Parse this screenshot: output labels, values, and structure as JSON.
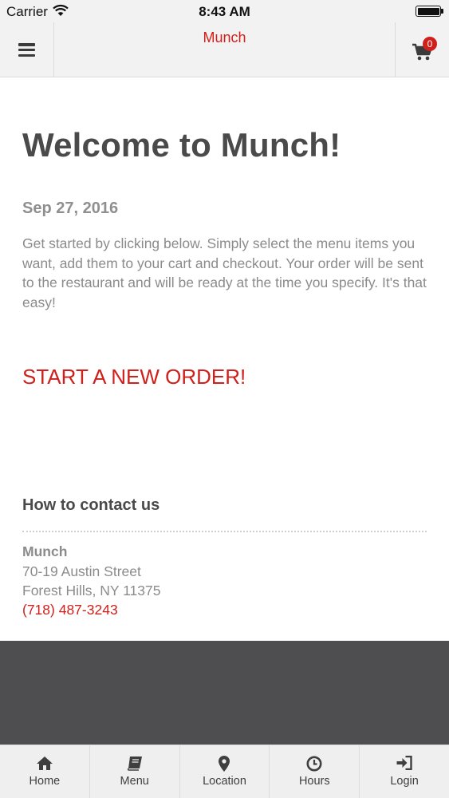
{
  "status_bar": {
    "carrier": "Carrier",
    "time": "8:43 AM"
  },
  "navbar": {
    "title": "Munch",
    "cart_count": "0"
  },
  "welcome": {
    "heading": "Welcome to Munch!",
    "date": "Sep 27, 2016",
    "intro": "Get started by clicking below. Simply select the menu items you want, add them to your cart and checkout. Your order will be sent to the restaurant and will be ready at the time you specify. It's that easy!",
    "cta_label": "START A NEW ORDER!"
  },
  "contact": {
    "heading": "How to contact us",
    "name": "Munch",
    "address_line1": "70-19 Austin Street",
    "address_line2": "Forest Hills, NY 11375",
    "phone": "(718) 487-3243"
  },
  "tabs": [
    {
      "label": "Home",
      "icon": "home-icon"
    },
    {
      "label": "Menu",
      "icon": "book-icon"
    },
    {
      "label": "Location",
      "icon": "map-pin-icon"
    },
    {
      "label": "Hours",
      "icon": "clock-icon"
    },
    {
      "label": "Login",
      "icon": "login-icon"
    }
  ],
  "colors": {
    "accent": "#d0201b",
    "heading": "#4a4a4a",
    "body_text": "#8b8b8b",
    "bar_background": "#f2f2f2",
    "footer_dark": "#4e4d4f"
  }
}
